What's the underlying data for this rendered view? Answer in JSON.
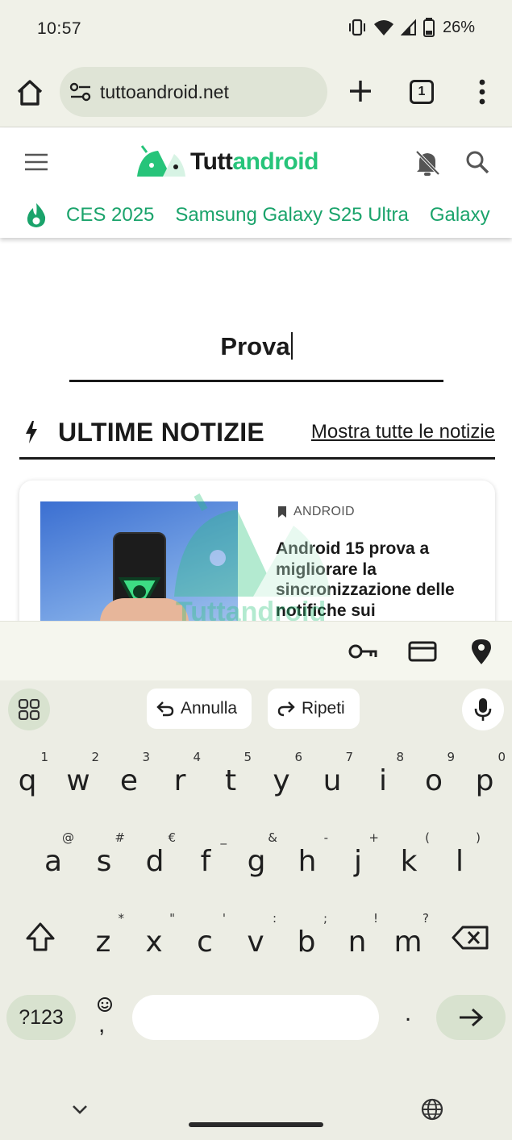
{
  "status_bar": {
    "time": "10:57",
    "battery": "26%",
    "icons": [
      "vibrate-icon",
      "wifi-icon",
      "signal-icon",
      "battery-icon"
    ]
  },
  "browser": {
    "url": "tuttoandroid.net",
    "tab_count": "1",
    "icons": [
      "home-icon",
      "site-settings-icon",
      "new-tab-icon",
      "tab-switcher-icon",
      "overflow-menu-icon"
    ]
  },
  "site": {
    "brand_part1": "Tutt",
    "brand_part2": "android",
    "trending": [
      "CES 2025",
      "Samsung Galaxy S25 Ultra",
      "Galaxy"
    ],
    "colors": {
      "brand_green": "#27c47a",
      "link_green": "#1aa36b"
    }
  },
  "search": {
    "term": "Prova"
  },
  "news": {
    "section_title": "ULTIME NOTIZIE",
    "show_all": "Mostra tutte le notizie",
    "card": {
      "category": "ANDROID",
      "headline": "Android 15 prova a migliorare la sincronizzazione delle notifiche sui"
    },
    "watermark_text": "Tuttandroid"
  },
  "autofill": {
    "icons": [
      "password-key-icon",
      "payment-card-icon",
      "address-location-icon"
    ]
  },
  "keyboard": {
    "suggestions": [
      "Annulla",
      "Ripeti"
    ],
    "row1": [
      {
        "k": "q",
        "h": "1"
      },
      {
        "k": "w",
        "h": "2"
      },
      {
        "k": "e",
        "h": "3"
      },
      {
        "k": "r",
        "h": "4"
      },
      {
        "k": "t",
        "h": "5"
      },
      {
        "k": "y",
        "h": "6"
      },
      {
        "k": "u",
        "h": "7"
      },
      {
        "k": "i",
        "h": "8"
      },
      {
        "k": "o",
        "h": "9"
      },
      {
        "k": "p",
        "h": "0"
      }
    ],
    "row2": [
      {
        "k": "a",
        "h": "@"
      },
      {
        "k": "s",
        "h": "#"
      },
      {
        "k": "d",
        "h": "€"
      },
      {
        "k": "f",
        "h": "_"
      },
      {
        "k": "g",
        "h": "&"
      },
      {
        "k": "h",
        "h": "-"
      },
      {
        "k": "j",
        "h": "+"
      },
      {
        "k": "k",
        "h": "("
      },
      {
        "k": "l",
        "h": ")"
      }
    ],
    "row3": [
      {
        "k": "z",
        "h": "*"
      },
      {
        "k": "x",
        "h": "\""
      },
      {
        "k": "c",
        "h": "'"
      },
      {
        "k": "v",
        "h": ":"
      },
      {
        "k": "b",
        "h": ";"
      },
      {
        "k": "n",
        "h": "!"
      },
      {
        "k": "m",
        "h": "?"
      }
    ],
    "symbols_label": "?123",
    "comma": ",",
    "period": "."
  }
}
